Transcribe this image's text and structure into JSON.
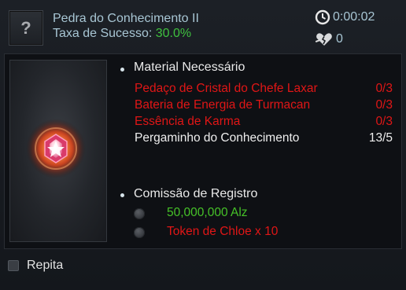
{
  "header": {
    "slot_glyph": "?",
    "item_name": "Pedra do Conhecimento II",
    "success_label": "Taxa de Sucesso:",
    "success_value": "30.0%",
    "timer": "0:00:02",
    "count": "0"
  },
  "icons": {
    "slot": "question-mark-icon",
    "timer": "clock-icon",
    "count": "broken-heart-icon",
    "preview": "glowing-gem-icon",
    "bullet": "dot-icon"
  },
  "materials": {
    "title": "Material Necessário",
    "items": [
      {
        "name": "Pedaço de Cristal do Chefe Laxar",
        "count": "0/3",
        "status": "missing"
      },
      {
        "name": "Bateria de Energia de Turmacan",
        "count": "0/3",
        "status": "missing"
      },
      {
        "name": "Essência de Karma",
        "count": "0/3",
        "status": "missing"
      },
      {
        "name": "Pergaminho do Conhecimento",
        "count": "13/5",
        "status": "ok"
      }
    ]
  },
  "fee": {
    "title": "Comissão de Registro",
    "options": [
      {
        "text": "50,000,000 Alz",
        "color": "#46c228"
      },
      {
        "text": "Token de Chloe x 10",
        "color": "#e01616"
      }
    ]
  },
  "footer": {
    "repeat_label": "Repita",
    "repeat_checked": false
  },
  "colors": {
    "missing": "#e01616",
    "ok": "#eeeeee",
    "success": "#3fc03f",
    "label_blue": "#a8c6d4"
  }
}
